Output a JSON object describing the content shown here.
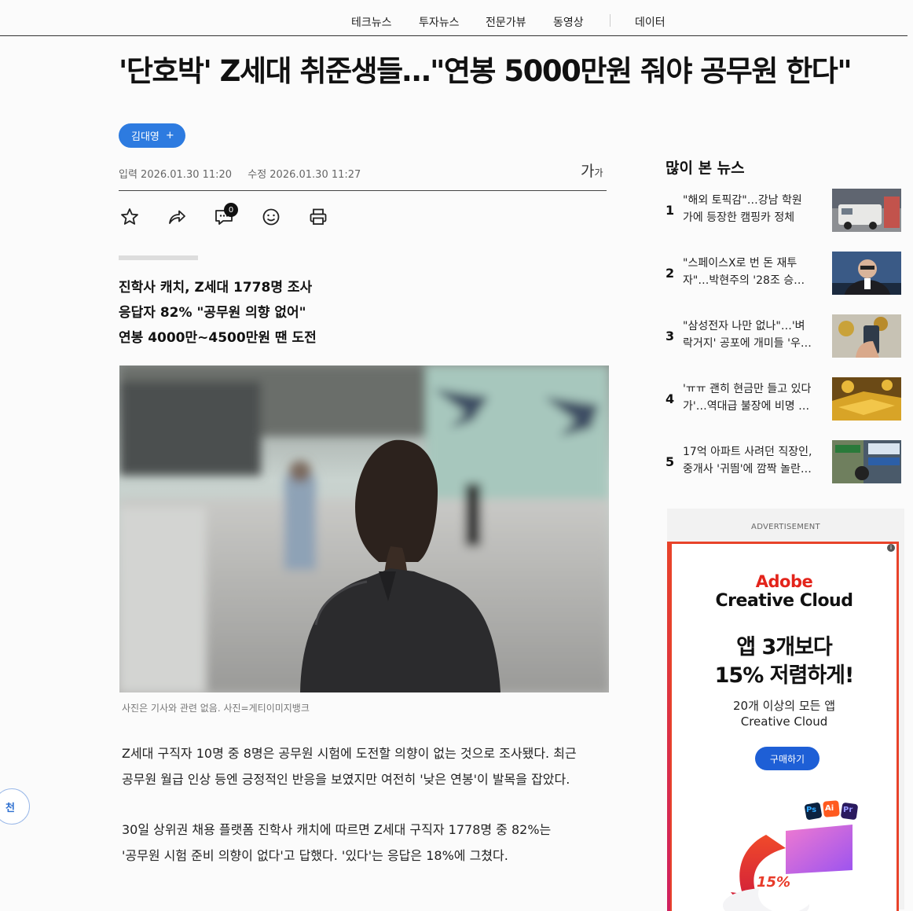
{
  "nav": {
    "items": [
      "테크뉴스",
      "투자뉴스",
      "전문가뷰",
      "동영상",
      "데이터"
    ]
  },
  "article": {
    "headline": "'단호박' Z세대 취준생들…\"연봉 5000만원 줘야 공무원 한다\"",
    "author": "김대영",
    "author_plus": "+",
    "published": "입력 2026.01.30 11:20",
    "modified": "수정 2026.01.30 11:27",
    "font_size_big": "가",
    "font_size_small": "가",
    "comment_count": "0",
    "icons": [
      "star-icon",
      "share-icon",
      "comment-icon",
      "emoji-icon",
      "print-icon"
    ],
    "summary": [
      "진학사 캐치, Z세대 1778명 조사",
      "응답자 82% \"공무원 의향 없어\"",
      "연봉 4000만~4500만원 땐 도전"
    ],
    "photo_caption": "사진은 기사와 관련 없음. 사진=게티이미지뱅크",
    "paragraphs": [
      [
        "Z세대 구직자 10명 중 8명은 공무원 시험에 도전할 의향이 없는 것으로 조사됐다. 최근",
        "공무원 월급 인상 등엔 긍정적인 반응을 보였지만 여전히 '낮은 연봉'이 발목을 잡았다."
      ],
      [
        "30일 상위권 채용 플랫폼 진학사 캐치에 따르면 Z세대 구직자 1778명 중 82%는",
        "'공무원 시험 준비 의향이 없다'고 답했다. '있다'는 응답은 18%에 그쳤다."
      ]
    ]
  },
  "sidebar": {
    "title": "많이 본 뉴스",
    "items": [
      {
        "rank": "1",
        "line1": "\"해외 토픽감\"…강남 학원",
        "line2": "가에 등장한 캠핑카 정체"
      },
      {
        "rank": "2",
        "line1": "\"스페이스X로 번 돈 재투",
        "line2": "자\"…박현주의 '28조 승…"
      },
      {
        "rank": "3",
        "line1": "\"삼성전자 나만 없나\"…'벼",
        "line2": "락거지' 공포에 개미들 '우…"
      },
      {
        "rank": "4",
        "line1": "'ㅠㅠ 괜히 현금만 들고 있다",
        "line2": "가'…역대급 불장에 비명 …"
      },
      {
        "rank": "5",
        "line1": "17억 아파트 사려던 직장인,",
        "line2": "중개사 '귀띔'에 깜짝 놀란…"
      }
    ]
  },
  "ad": {
    "label": "ADVERTISEMENT",
    "brand": "Adobe",
    "product": "Creative Cloud",
    "headline_1": "앱 3개보다",
    "headline_2": "15% 저렴하게!",
    "sub_1": "20개 이상의 모든 앱",
    "sub_2": "Creative Cloud",
    "cta": "구매하기",
    "badge": "15%",
    "app_badges": [
      "Ps",
      "Ai",
      "Pr"
    ]
  },
  "floating": {
    "label": "천"
  }
}
